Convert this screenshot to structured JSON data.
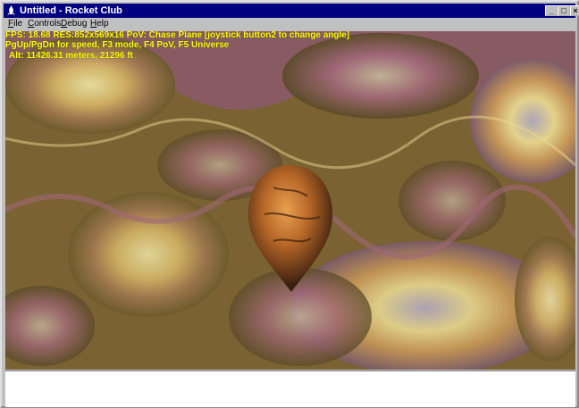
{
  "window": {
    "title": "Untitled - Rocket Club",
    "buttons": {
      "minimize": "_",
      "maximize": "□",
      "close": "×"
    }
  },
  "menubar": {
    "items": [
      {
        "label": "File",
        "accel": "F"
      },
      {
        "label": "Controls",
        "accel": "C"
      },
      {
        "label": "Debug",
        "accel": "D"
      },
      {
        "label": "Help",
        "accel": "H"
      }
    ]
  },
  "hud": {
    "line1": "FPS: 18.68 RES:852x569x16 PoV: Chase Plane [joystick button2 to change angle]",
    "line2": "PgUp/PgDn for speed, F3 mode, F4 PoV, F5 Universe",
    "line3": "Alt: 11426.31 meters, 21296 ft"
  },
  "colors": {
    "title_bar": "#000080",
    "hud_text": "#ffff00",
    "terrain_dark": "#6b5a2a",
    "terrain_mauve": "#8a5a6a",
    "terrain_light": "#e8d890"
  }
}
